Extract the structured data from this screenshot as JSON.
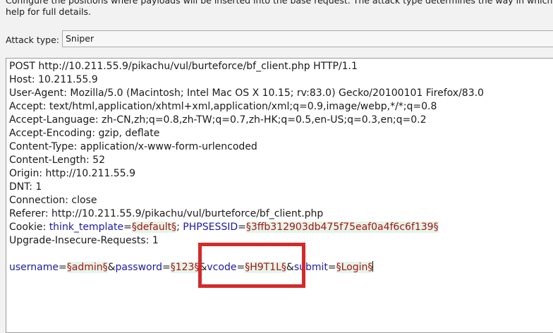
{
  "intro": {
    "line1": "Configure the positions where payloads will be inserted into the base request. The attack type determines the way in which",
    "line2": "help for full details."
  },
  "attack_type": {
    "label": "Attack type:",
    "value": "Sniper"
  },
  "request": {
    "lines": [
      "POST http://10.211.55.9/pikachu/vul/burteforce/bf_client.php HTTP/1.1",
      "Host: 10.211.55.9",
      "User-Agent: Mozilla/5.0 (Macintosh; Intel Mac OS X 10.15; rv:83.0) Gecko/20100101 Firefox/83.0",
      "Accept: text/html,application/xhtml+xml,application/xml;q=0.9,image/webp,*/*;q=0.8",
      "Accept-Language: zh-CN,zh;q=0.8,zh-TW;q=0.7,zh-HK;q=0.5,en-US;q=0.3,en;q=0.2",
      "Accept-Encoding: gzip, deflate",
      "Content-Type: application/x-www-form-urlencoded",
      "Content-Length: 52",
      "Origin: http://10.211.55.9",
      "DNT: 1",
      "Connection: close",
      "Referer: http://10.211.55.9/pikachu/vul/burteforce/bf_client.php"
    ],
    "cookie": {
      "prefix": "Cookie: ",
      "name1": "think_template",
      "eq1": "=",
      "value1": "§default§",
      "sep": "; ",
      "name2": "PHPSESSID",
      "eq2": "=",
      "value2": "§3ffb312903db475f75eaf0a4f6c6f139§"
    },
    "upgrade_line": "Upgrade-Insecure-Requests: 1",
    "body": {
      "p1_name": "username",
      "p1_value": "§admin§",
      "p2_name": "password",
      "p2_value": "§123§",
      "p3_name": "vcode",
      "p3_value": "§H9T1L§",
      "p4_name": "submit",
      "p4_value": "§Login§",
      "eq": "=",
      "amp": "&"
    }
  },
  "colors": {
    "param_name": "#1a1aa6",
    "param_value": "#a31515",
    "payload_marker_bg": "#e6f4e8",
    "annotation_box": "#d32a2a"
  }
}
